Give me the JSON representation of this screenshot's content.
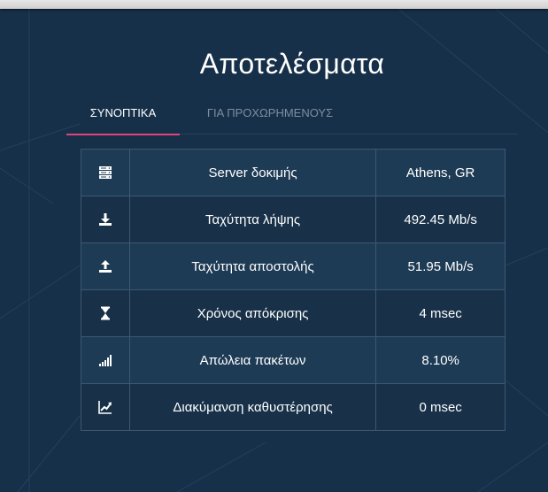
{
  "page": {
    "title": "Αποτελέσματα"
  },
  "tabs": [
    {
      "label": "ΣΥΝΟΠΤΙΚΑ",
      "active": true
    },
    {
      "label": "ΓΙΑ ΠΡΟΧΩΡΗΜΕΝΟΥΣ",
      "active": false
    }
  ],
  "results": {
    "rows": [
      {
        "icon": "server-icon",
        "label": "Server δοκιμής",
        "value": "Athens, GR"
      },
      {
        "icon": "download-icon",
        "label": "Ταχύτητα λήψης",
        "value": "492.45 Mb/s"
      },
      {
        "icon": "upload-icon",
        "label": "Ταχύτητα αποστολής",
        "value": "51.95 Mb/s"
      },
      {
        "icon": "hourglass-icon",
        "label": "Χρόνος απόκρισης",
        "value": "4 msec"
      },
      {
        "icon": "signal-bars-icon",
        "label": "Απώλεια πακέτων",
        "value": "8.10%"
      },
      {
        "icon": "line-chart-icon",
        "label": "Διακύμανση καθυστέρησης",
        "value": "0 msec"
      }
    ]
  },
  "colors": {
    "background": "#173049",
    "row_dark": "#183149",
    "row_light": "#1e3b55",
    "border": "#3c5772",
    "accent": "#e0447a",
    "inactive_tab": "#7c8ea0"
  }
}
